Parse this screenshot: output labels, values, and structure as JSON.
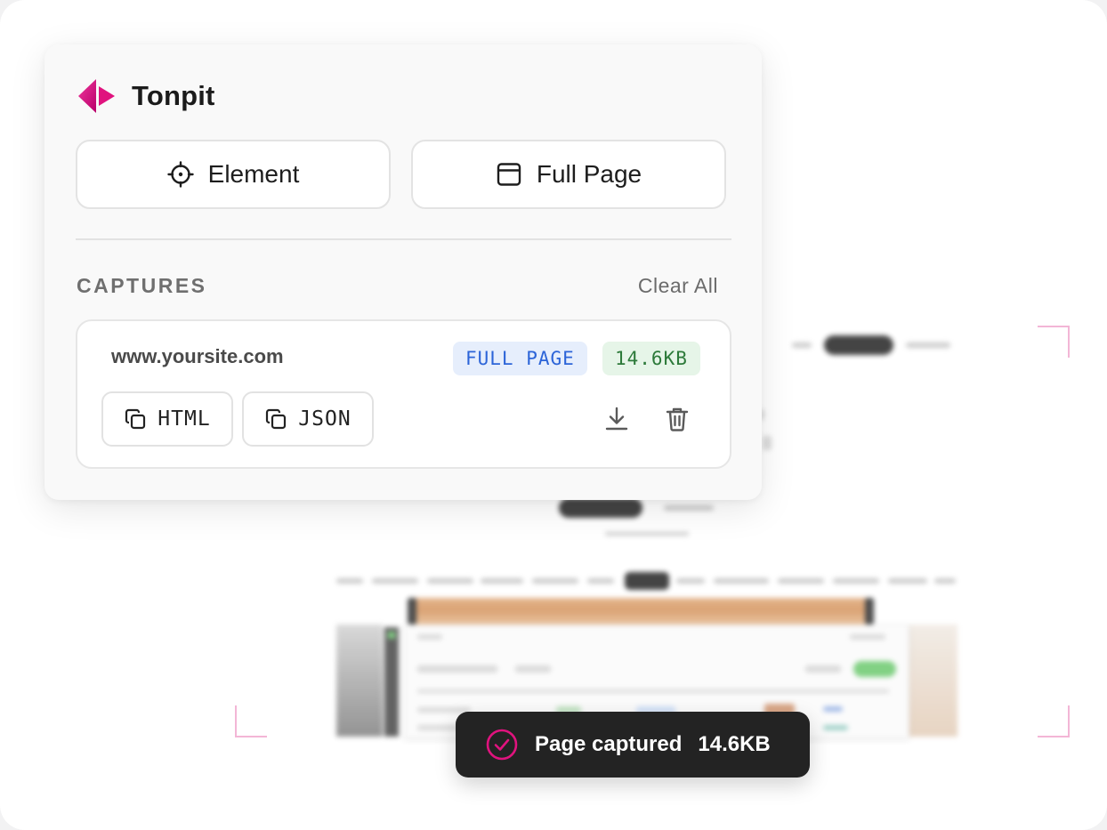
{
  "app": {
    "name": "Tonpit",
    "accent_color": "#e0137e"
  },
  "modes": {
    "element_label": "Element",
    "element_icon": "crosshair-icon",
    "fullpage_label": "Full Page",
    "fullpage_icon": "browser-window-icon"
  },
  "captures": {
    "title": "CAPTURES",
    "clear_all_label": "Clear All",
    "items": [
      {
        "url": "www.yoursite.com",
        "type_badge": "FULL PAGE",
        "size_badge": "14.6KB",
        "copy_html_label": "HTML",
        "copy_json_label": "JSON",
        "copy_icon": "copy-icon",
        "download_icon": "download-icon",
        "delete_icon": "trash-icon"
      }
    ]
  },
  "toast": {
    "icon": "check-circle-icon",
    "message": "Page captured",
    "size": "14.6KB",
    "icon_color": "#e0137e"
  }
}
